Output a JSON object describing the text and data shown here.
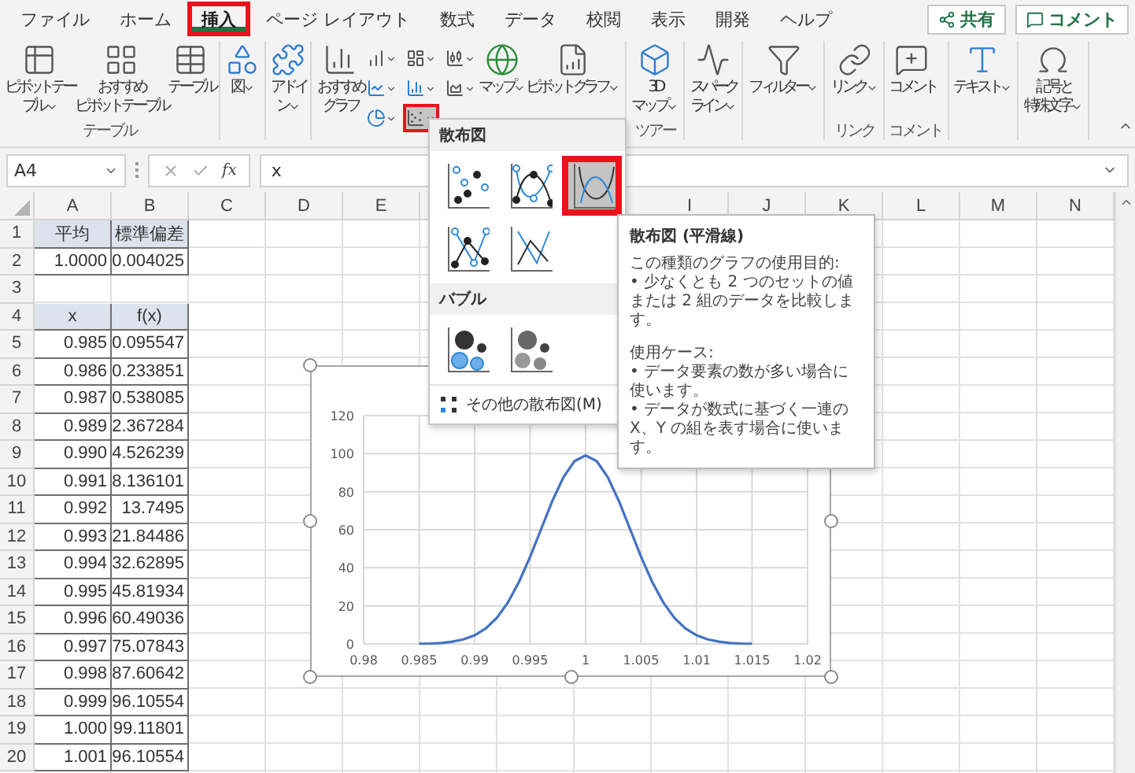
{
  "tabs": [
    {
      "label": "ファイル",
      "selected": false,
      "annotated": false
    },
    {
      "label": "ホーム",
      "selected": false,
      "annotated": false
    },
    {
      "label": "挿入",
      "selected": true,
      "annotated": true
    },
    {
      "label": "ページ レイアウト",
      "selected": false,
      "annotated": false
    },
    {
      "label": "数式",
      "selected": false,
      "annotated": false
    },
    {
      "label": "データ",
      "selected": false,
      "annotated": false
    },
    {
      "label": "校閲",
      "selected": false,
      "annotated": false
    },
    {
      "label": "表示",
      "selected": false,
      "annotated": false
    },
    {
      "label": "開発",
      "selected": false,
      "annotated": false
    },
    {
      "label": "ヘルプ",
      "selected": false,
      "annotated": false
    }
  ],
  "share_button": {
    "label": "共有"
  },
  "comment_button": {
    "label": "コメント"
  },
  "ribbon_groups": [
    {
      "label": "テーブル",
      "buttons": [
        {
          "kind": "pivot-table",
          "lines": [
            "ピボットテー",
            "ブル"
          ],
          "dropdown": true
        },
        {
          "kind": "recommended-pivot",
          "lines": [
            "おすすめ",
            "ピボットテーブル"
          ],
          "dropdown": false
        },
        {
          "kind": "table",
          "lines": [
            "テーブル"
          ],
          "dropdown": false
        }
      ]
    },
    {
      "buttons": [
        {
          "kind": "shapes",
          "lines": [
            "図"
          ],
          "dropdown": true
        }
      ]
    },
    {
      "buttons": [
        {
          "kind": "add-in",
          "lines": [
            "アドイ",
            "ン"
          ],
          "dropdown": true
        }
      ]
    },
    {
      "buttons": [
        {
          "kind": "recommended-chart",
          "lines": [
            "おすすめ",
            "グラフ"
          ],
          "dropdown": false
        }
      ],
      "small_buttons": [
        {
          "kind": "column",
          "pressed": false,
          "annotated": false
        },
        {
          "kind": "hierarchy",
          "pressed": false,
          "annotated": false
        },
        {
          "kind": "waterfall",
          "pressed": false,
          "annotated": false
        },
        {
          "kind": "line",
          "pressed": false,
          "annotated": false
        },
        {
          "kind": "statistic",
          "pressed": false,
          "annotated": false
        },
        {
          "kind": "combo",
          "pressed": false,
          "annotated": false
        },
        {
          "kind": "pie",
          "pressed": false,
          "annotated": false
        },
        {
          "kind": "scatter",
          "pressed": true,
          "annotated": true
        }
      ],
      "after_buttons": [
        {
          "kind": "map",
          "lines": [
            "マップ"
          ],
          "dropdown": true
        },
        {
          "kind": "pivot-chart",
          "lines": [
            "ピボットグラフ"
          ],
          "dropdown": true
        }
      ]
    },
    {
      "label": "ツアー",
      "buttons": [
        {
          "kind": "tour",
          "lines": [
            "3D",
            "マップ"
          ],
          "dropdown": true
        }
      ]
    },
    {
      "buttons": [
        {
          "kind": "sparkline",
          "lines": [
            "スパーク",
            "ライン"
          ],
          "dropdown": true
        }
      ]
    },
    {
      "buttons": [
        {
          "kind": "filter",
          "lines": [
            "フィルター"
          ],
          "dropdown": true
        }
      ]
    },
    {
      "label": "リンク",
      "buttons": [
        {
          "kind": "link",
          "lines": [
            "リンク"
          ],
          "dropdown": true
        }
      ]
    },
    {
      "label": "コメント",
      "buttons": [
        {
          "kind": "comment",
          "lines": [
            "コメント"
          ],
          "dropdown": false
        }
      ]
    },
    {
      "buttons": [
        {
          "kind": "text",
          "lines": [
            "テキスト"
          ],
          "dropdown": true
        }
      ]
    },
    {
      "buttons": [
        {
          "kind": "symbol",
          "lines": [
            "記号と",
            "特殊文字"
          ],
          "dropdown": true
        }
      ]
    }
  ],
  "formula_bar": {
    "name_box": "A4",
    "function_label": "fx",
    "value": "x"
  },
  "columns_left": [
    "A",
    "B",
    "C",
    "D",
    "E"
  ],
  "columns_right": [
    "I",
    "J",
    "K",
    "L",
    "M",
    "N"
  ],
  "rows": [
    {
      "number": "1",
      "cells": [
        {
          "text": "平均",
          "kind": "header"
        },
        {
          "text": "標準偏差",
          "kind": "header"
        }
      ]
    },
    {
      "number": "2",
      "cells": [
        {
          "text": "1.0000",
          "kind": "value"
        },
        {
          "text": "0.004025",
          "kind": "value"
        }
      ]
    },
    {
      "number": "3"
    },
    {
      "number": "4",
      "cells": [
        {
          "text": "x",
          "kind": "header"
        },
        {
          "text": "f(x)",
          "kind": "header"
        }
      ]
    },
    {
      "number": "5",
      "cells": [
        {
          "text": "0.985",
          "kind": "value"
        },
        {
          "text": "0.095547",
          "kind": "value"
        }
      ]
    },
    {
      "number": "6",
      "cells": [
        {
          "text": "0.986",
          "kind": "value"
        },
        {
          "text": "0.233851",
          "kind": "value"
        }
      ]
    },
    {
      "number": "7",
      "cells": [
        {
          "text": "0.987",
          "kind": "value"
        },
        {
          "text": "0.538085",
          "kind": "value"
        }
      ]
    },
    {
      "number": "8",
      "cells": [
        {
          "text": "0.989",
          "kind": "value"
        },
        {
          "text": "2.367284",
          "kind": "value"
        }
      ]
    },
    {
      "number": "9",
      "cells": [
        {
          "text": "0.990",
          "kind": "value"
        },
        {
          "text": "4.526239",
          "kind": "value"
        }
      ]
    },
    {
      "number": "10",
      "cells": [
        {
          "text": "0.991",
          "kind": "value"
        },
        {
          "text": "8.136101",
          "kind": "value"
        }
      ]
    },
    {
      "number": "11",
      "cells": [
        {
          "text": "0.992",
          "kind": "value"
        },
        {
          "text": "13.7495",
          "kind": "value"
        }
      ]
    },
    {
      "number": "12",
      "cells": [
        {
          "text": "0.993",
          "kind": "value"
        },
        {
          "text": "21.84486",
          "kind": "value"
        }
      ]
    },
    {
      "number": "13",
      "cells": [
        {
          "text": "0.994",
          "kind": "value"
        },
        {
          "text": "32.62895",
          "kind": "value"
        }
      ]
    },
    {
      "number": "14",
      "cells": [
        {
          "text": "0.995",
          "kind": "value"
        },
        {
          "text": "45.81934",
          "kind": "value"
        }
      ]
    },
    {
      "number": "15",
      "cells": [
        {
          "text": "0.996",
          "kind": "value"
        },
        {
          "text": "60.49036",
          "kind": "value"
        }
      ]
    },
    {
      "number": "16",
      "cells": [
        {
          "text": "0.997",
          "kind": "value"
        },
        {
          "text": "75.07843",
          "kind": "value"
        }
      ]
    },
    {
      "number": "17",
      "cells": [
        {
          "text": "0.998",
          "kind": "value"
        },
        {
          "text": "87.60642",
          "kind": "value"
        }
      ]
    },
    {
      "number": "18",
      "cells": [
        {
          "text": "0.999",
          "kind": "value"
        },
        {
          "text": "96.10554",
          "kind": "value"
        }
      ]
    },
    {
      "number": "19",
      "cells": [
        {
          "text": "1.000",
          "kind": "value"
        },
        {
          "text": "99.11801",
          "kind": "value"
        }
      ]
    },
    {
      "number": "20",
      "cells": [
        {
          "text": "1.001",
          "kind": "value"
        },
        {
          "text": "96.10554",
          "kind": "value"
        }
      ]
    }
  ],
  "chart": {
    "chart_data": {
      "type": "line",
      "x": [
        0.985,
        0.986,
        0.987,
        0.988,
        0.989,
        0.99,
        0.991,
        0.992,
        0.993,
        0.994,
        0.995,
        0.996,
        0.997,
        0.998,
        0.999,
        1,
        1.001,
        1.002,
        1.003,
        1.004,
        1.005,
        1.006,
        1.007,
        1.008,
        1.009,
        1.01,
        1.011,
        1.012,
        1.013,
        1.014,
        1.015
      ],
      "series": [
        {
          "color": "#4472c4",
          "values": [
            0.1,
            0.2,
            0.5,
            1.2,
            2.4,
            4.5,
            8.1,
            13.7,
            21.8,
            32.6,
            45.8,
            60.5,
            75.1,
            87.6,
            96.1,
            99.1,
            96.1,
            87.6,
            75.1,
            60.5,
            45.8,
            32.6,
            21.8,
            13.7,
            8.1,
            4.5,
            2.4,
            1.2,
            0.5,
            0.2,
            0.1
          ]
        }
      ],
      "grid": true,
      "xlim": [
        0.98,
        1.02
      ],
      "ylim": [
        0,
        120
      ],
      "xticks": [
        0.98,
        0.985,
        0.99,
        0.995,
        1,
        1.005,
        1.01,
        1.015,
        1.02
      ],
      "yticks": [
        0,
        20,
        40,
        60,
        80,
        100,
        120
      ]
    }
  },
  "scatter_menu": {
    "sections": [
      {
        "title": "散布図",
        "items": [
          {
            "kind": "markers",
            "selected": false,
            "annotated": false
          },
          {
            "kind": "smooth-markers",
            "selected": false,
            "annotated": false
          },
          {
            "kind": "smooth",
            "selected": true,
            "annotated": true
          },
          {
            "kind": "straight-markers",
            "selected": false,
            "annotated": false
          },
          {
            "kind": "straight",
            "selected": false,
            "annotated": false
          }
        ]
      },
      {
        "title": "バブル",
        "items": [
          {
            "kind": "bubble",
            "selected": false,
            "annotated": false
          },
          {
            "kind": "bubble-3d",
            "selected": false,
            "annotated": false
          }
        ]
      }
    ],
    "footer": "その他の散布図(M)"
  },
  "tooltip": {
    "title": "散布図 (平滑線)",
    "sections": [
      {
        "heading": "この種類のグラフの使用目的:",
        "bullets": [
          "• 少なくとも 2 つのセットの値または 2 組のデータを比較します。"
        ]
      },
      {
        "heading": "使用ケース:",
        "bullets": [
          "• データ要素の数が多い場合に使います。",
          "• データが数式に基づく一連の X、Y の組を表す場合に使います。"
        ]
      }
    ]
  }
}
